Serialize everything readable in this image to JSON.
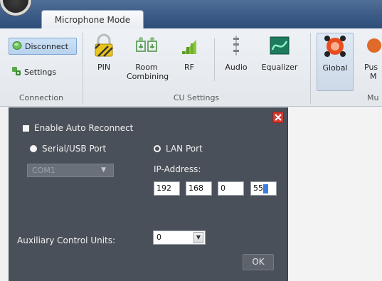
{
  "window": {
    "tab_label": "Microphone Mode"
  },
  "ribbon": {
    "connection": {
      "disconnect_label": "Disconnect",
      "settings_label": "Settings",
      "group_label": "Connection"
    },
    "cu_settings": {
      "group_label": "CU Settings",
      "buttons": [
        {
          "label": "PIN",
          "icon": "lock-icon"
        },
        {
          "label_line1": "Room",
          "label_line2": "Combining",
          "icon": "room-combining-icon"
        },
        {
          "label": "RF",
          "icon": "signal-bars-icon"
        },
        {
          "label": "Audio",
          "icon": "audio-sliders-icon"
        },
        {
          "label": "Equalizer",
          "icon": "equalizer-icon"
        }
      ]
    },
    "next_group": {
      "global_label": "Global",
      "partial_label_line1": "Pus",
      "partial_label_line2": "M",
      "partial_group_label": "Mu"
    }
  },
  "dialog": {
    "enable_auto_reconnect": "Enable Auto Reconnect",
    "serial_port_label": "Serial/USB Port",
    "lan_port_label": "LAN Port",
    "com_port_value": "COM1",
    "ip_address_label": "IP-Address:",
    "ip_octets": [
      "192",
      "168",
      "0",
      "55"
    ],
    "aux_label": "Auxiliary Control Units:",
    "aux_value": "0",
    "ok_label": "OK"
  },
  "colors": {
    "dialog_bg": "#4a5059",
    "ribbon_bg": "#e6e9ee",
    "title_bar": "#3a5a86",
    "close_red": "#d6392f",
    "selection_blue": "#3b7de0"
  }
}
